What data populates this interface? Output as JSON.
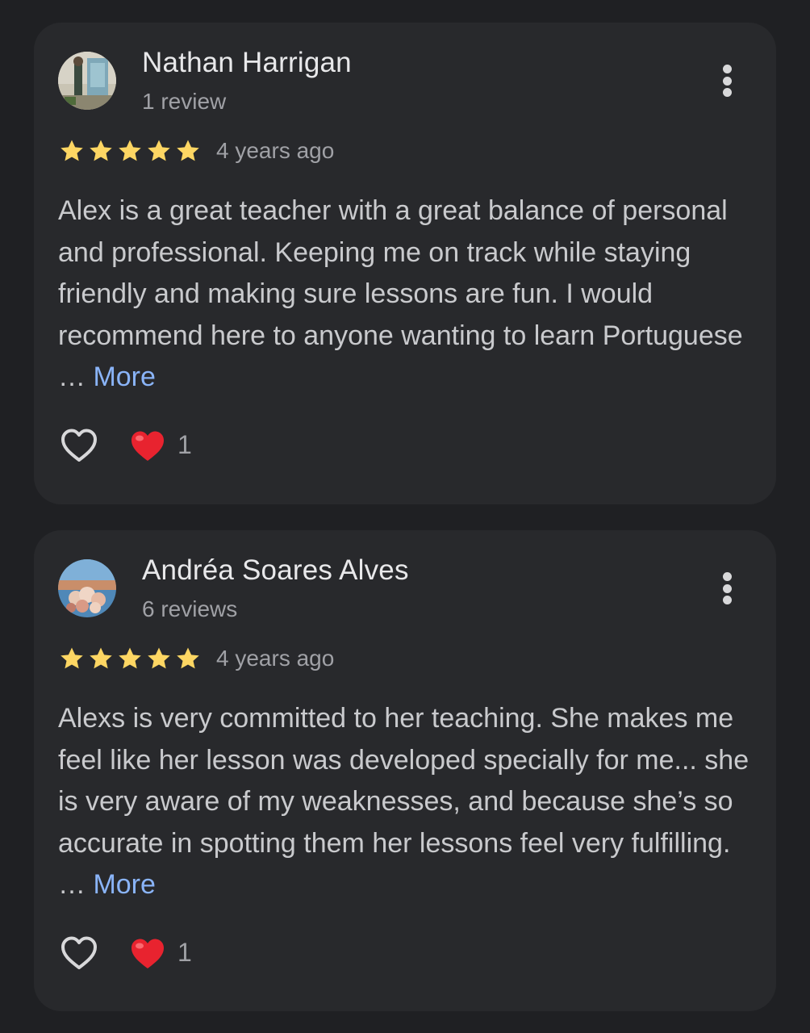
{
  "reviews": [
    {
      "name": "Nathan Harrigan",
      "review_count": "1 review",
      "rating": 5,
      "date": "4 years ago",
      "text": "Alex is a great teacher with a great balance of personal and professional. Keeping me on track while staying friendly and making sure lessons are fun. I would recommend here to anyone wanting to learn Portuguese …",
      "more_label": "More",
      "reaction_count": "1"
    },
    {
      "name": "Andréa Soares Alves",
      "review_count": "6 reviews",
      "rating": 5,
      "date": "4 years ago",
      "text": "Alexs is very committed to her teaching. She makes me feel like her lesson was developed specially for me... she is very aware of my weaknesses, and because she’s so accurate in spotting them her lessons feel very fulfilling. …",
      "more_label": "More",
      "reaction_count": "1"
    }
  ],
  "icons": {
    "menu": "more-vert-icon",
    "star": "star-icon",
    "like": "heart-outline-icon",
    "reaction": "red-heart-emoji-icon"
  },
  "colors": {
    "background": "#1f2023",
    "card": "#28292c",
    "star": "#fdd663",
    "link": "#8ab4f8",
    "heart": "#e8232f"
  }
}
